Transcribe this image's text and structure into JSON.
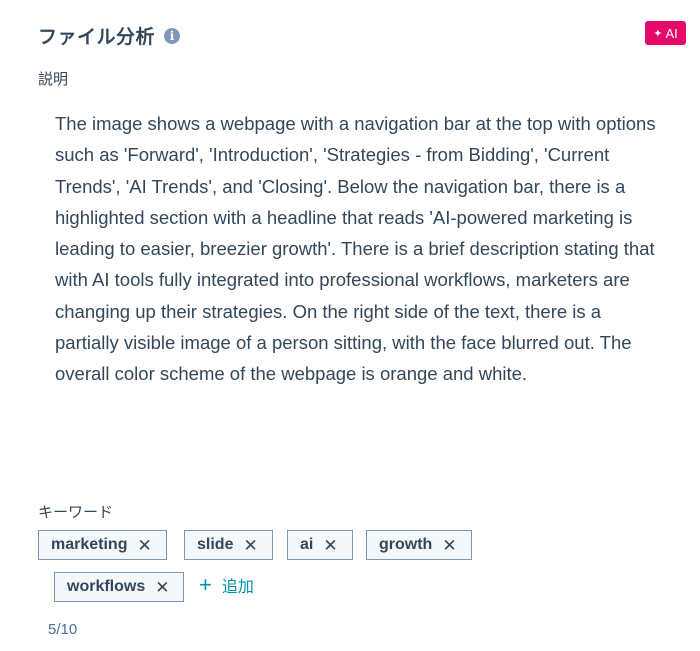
{
  "header": {
    "title": "ファイル分析",
    "info_icon": "info-icon",
    "ai_badge": {
      "icon": "sparkle-icon",
      "label": "AI",
      "color": "#e5096a"
    }
  },
  "description": {
    "label": "説明",
    "text": "The image shows a webpage with a navigation bar at the top with options such as 'Forward', 'Introduction', 'Strategies - from Bidding', 'Current Trends', 'AI Trends', and 'Closing'. Below the navigation bar, there is a highlighted section with a headline that reads 'AI-powered marketing is leading to easier, breezier growth'. There is a brief description stating that with AI tools fully integrated into professional workflows, marketers are changing up their strategies. On the right side of the text, there is a partially visible image of a person sitting, with the face blurred out. The overall color scheme of the webpage is orange and white."
  },
  "keywords": {
    "label": "キーワード",
    "tags": [
      {
        "label": "marketing",
        "remove_icon": "close-icon"
      },
      {
        "label": "slide",
        "remove_icon": "close-icon"
      },
      {
        "label": "ai",
        "remove_icon": "close-icon"
      },
      {
        "label": "growth",
        "remove_icon": "close-icon"
      },
      {
        "label": "workflows",
        "remove_icon": "close-icon"
      }
    ],
    "add_label": "追加",
    "add_icon": "plus-icon",
    "counter": "5/10"
  },
  "colors": {
    "text": "#33475b",
    "link": "#0091ae",
    "tag_border": "#7c98b6",
    "tag_bg": "#f5f8fa"
  }
}
